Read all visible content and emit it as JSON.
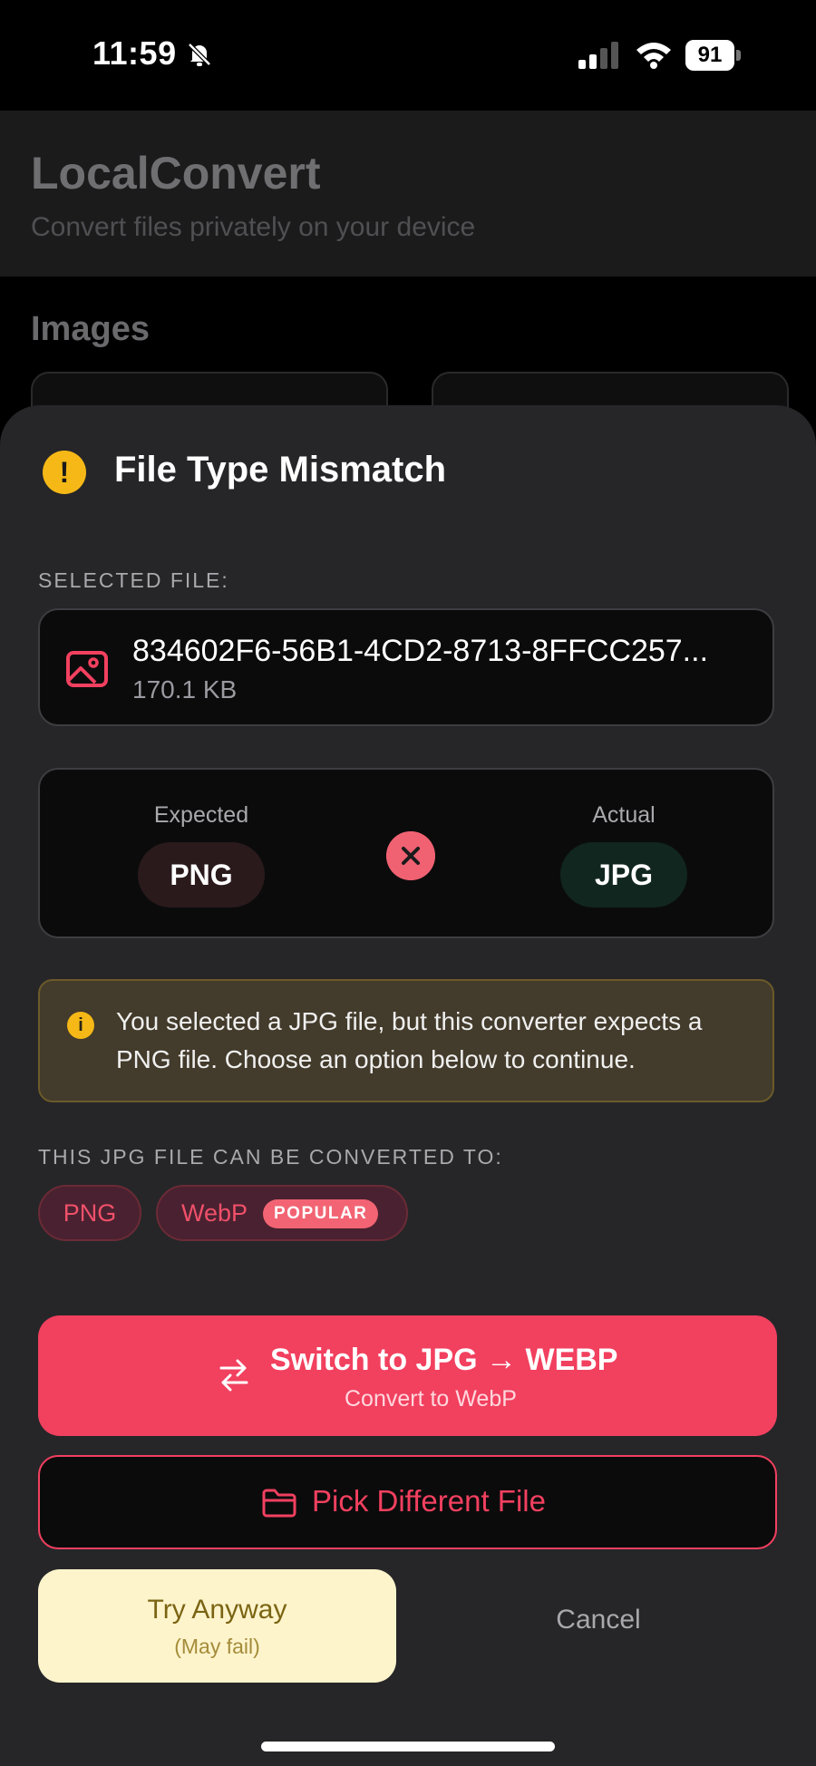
{
  "status_bar": {
    "time": "11:59",
    "battery": "91",
    "icons": [
      "bell-slash-icon",
      "signal-icon",
      "wifi-icon",
      "battery-icon"
    ]
  },
  "app": {
    "title": "LocalConvert",
    "subtitle": "Convert files privately on your device",
    "section": "Images"
  },
  "sheet": {
    "title": "File Type Mismatch",
    "selected_label": "SELECTED FILE:",
    "file": {
      "name": "834602F6-56B1-4CD2-8713-8FFCC257...",
      "size": "170.1 KB"
    },
    "expected_label": "Expected",
    "expected_value": "PNG",
    "actual_label": "Actual",
    "actual_value": "JPG",
    "info_text": "You selected a JPG file, but this converter expects a PNG file. Choose an option below to continue.",
    "convert_label": "THIS JPG FILE CAN BE CONVERTED TO:",
    "options": [
      {
        "label": "PNG"
      },
      {
        "label": "WebP",
        "badge": "POPULAR"
      }
    ],
    "primary_button": {
      "label": "Switch to JPG → WEBP",
      "sub": "Convert to WebP"
    },
    "secondary_button": "Pick Different File",
    "try_button": {
      "label": "Try Anyway",
      "sub": "(May fail)"
    },
    "cancel": "Cancel"
  },
  "colors": {
    "accent": "#f2405f",
    "warning": "#f5b816",
    "sheet_bg": "#262629"
  }
}
